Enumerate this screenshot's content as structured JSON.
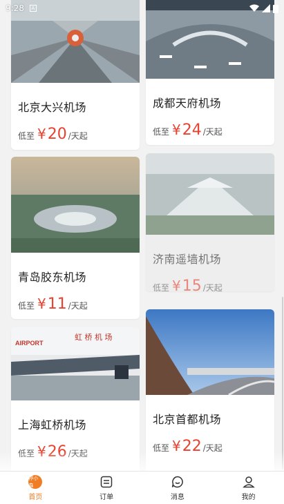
{
  "status": {
    "time": "9:28"
  },
  "cards": [
    {
      "name": "北京大兴机场",
      "low": "低至",
      "yen": "¥",
      "price": "20",
      "unit": "/天起"
    },
    {
      "name": "成都天府机场",
      "low": "低至",
      "yen": "¥",
      "price": "24",
      "unit": "/天起"
    },
    {
      "name": "青岛胶东机场",
      "low": "低至",
      "yen": "¥",
      "price": "11",
      "unit": "/天起"
    },
    {
      "name": "济南遥墙机场",
      "low": "低至",
      "yen": "¥",
      "price": "15",
      "unit": "/天起"
    },
    {
      "name": "上海虹桥机场",
      "low": "低至",
      "yen": "¥",
      "price": "26",
      "unit": "/天起"
    },
    {
      "name": "北京首都机场",
      "low": "低至",
      "yen": "¥",
      "price": "22",
      "unit": "/天起"
    }
  ],
  "tabbar": {
    "home_badge": "停小森",
    "home": "首页",
    "orders": "订单",
    "messages": "消息",
    "mine": "我的"
  },
  "colors": {
    "accent": "#f07d24",
    "price": "#e8422f"
  }
}
